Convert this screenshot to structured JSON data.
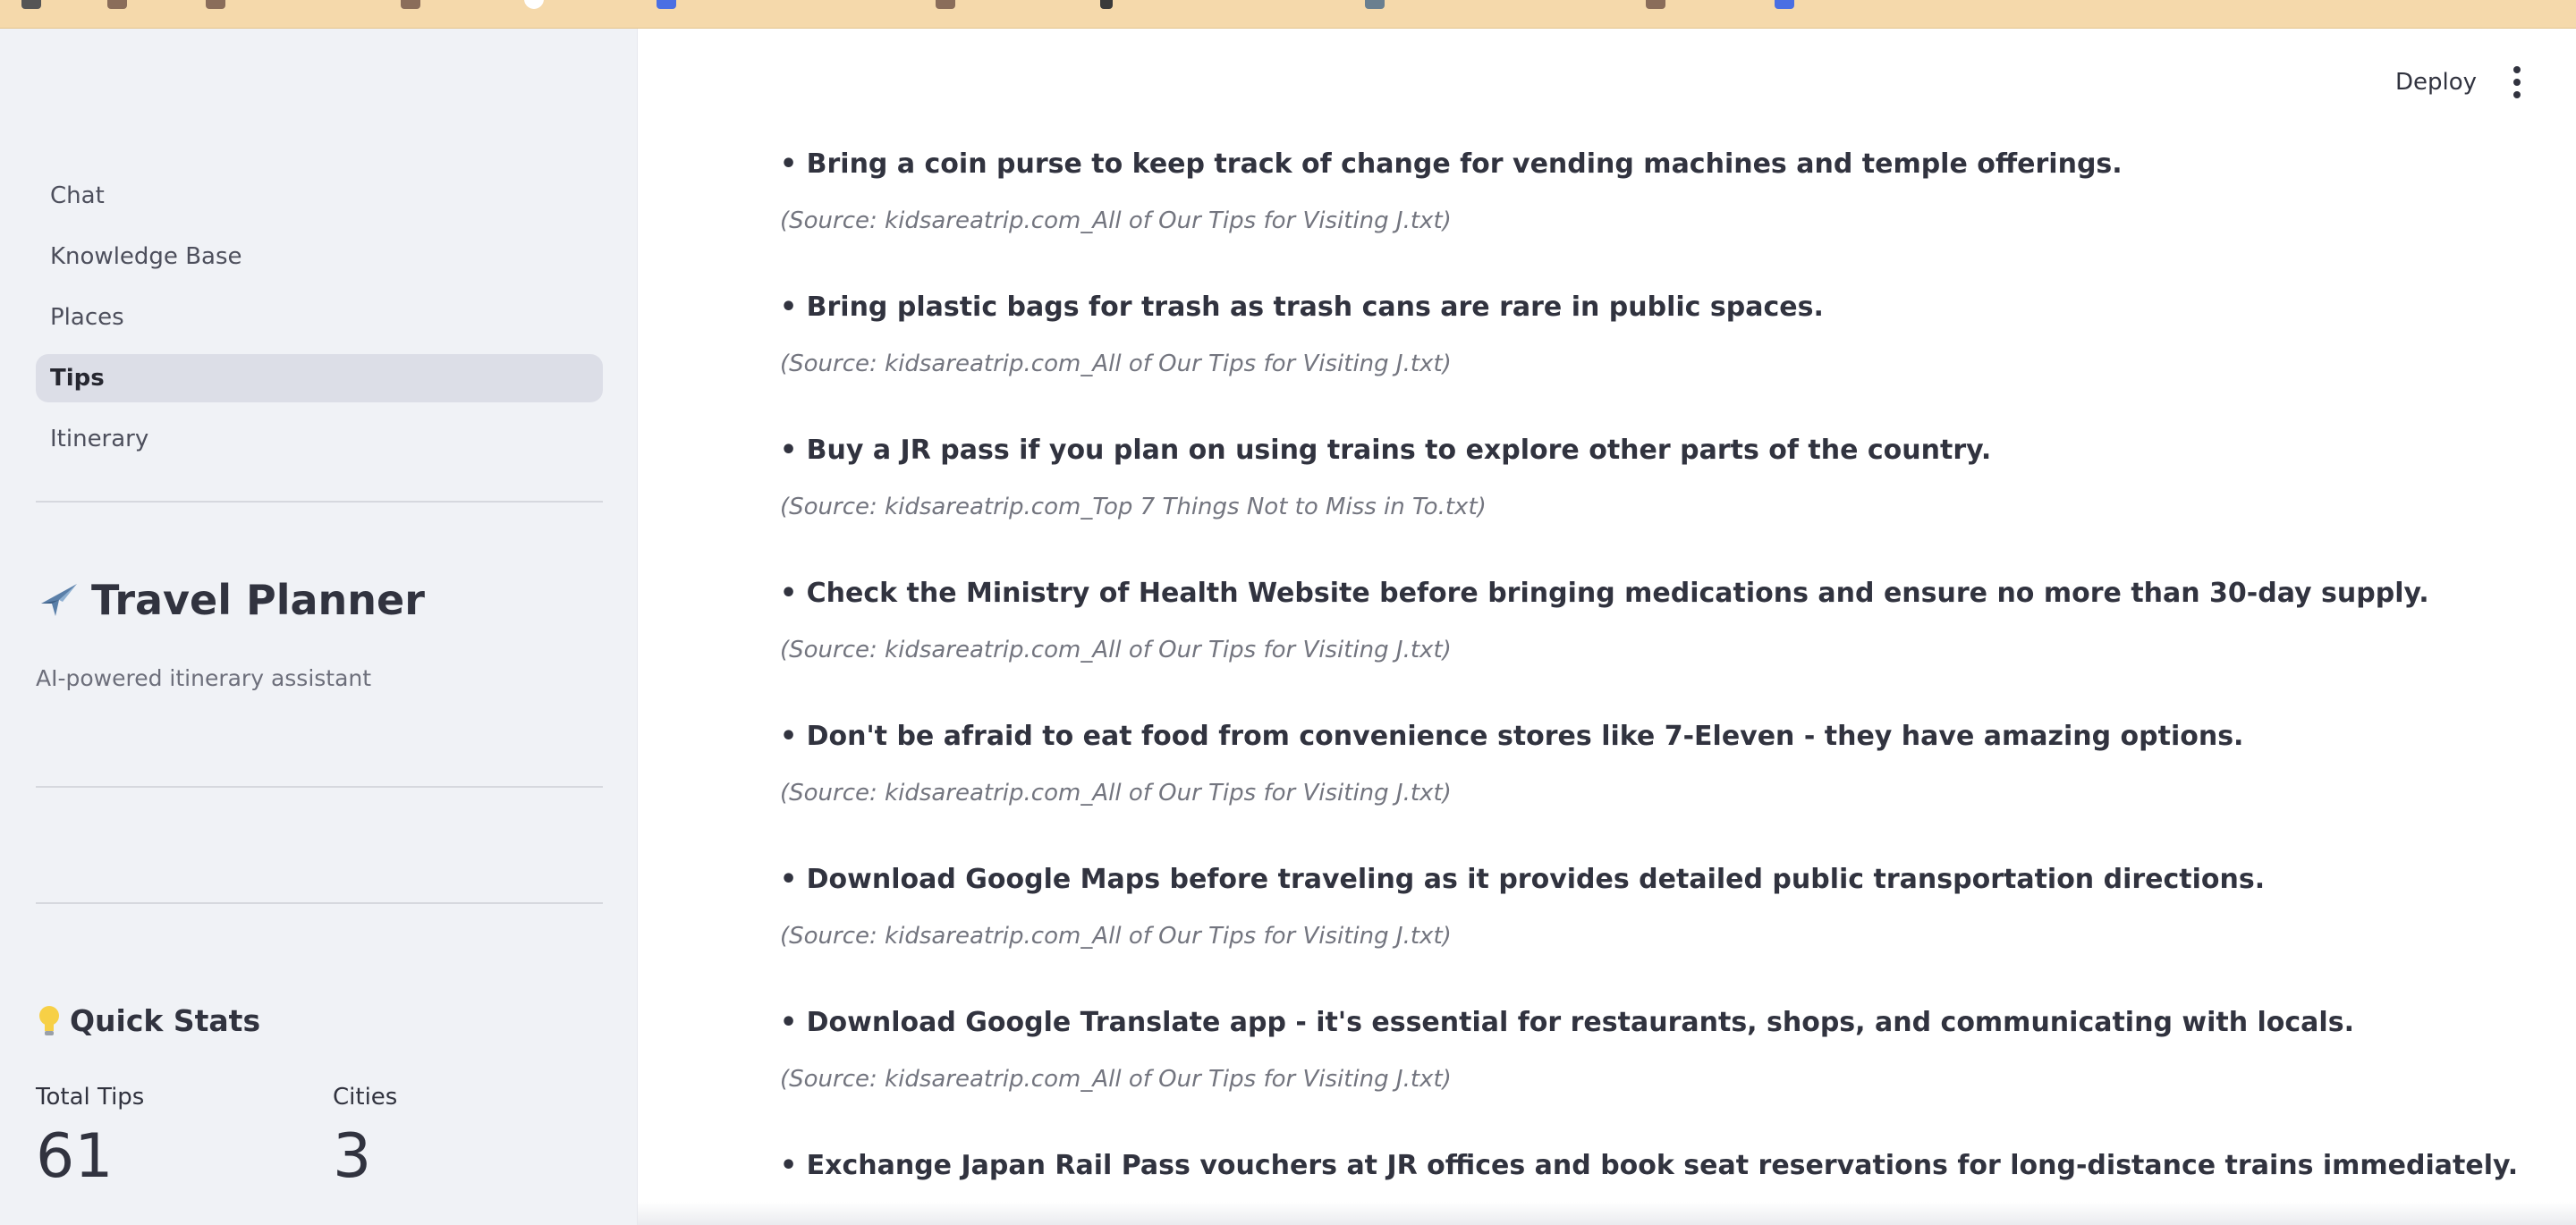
{
  "sidebar": {
    "nav_items": [
      {
        "label": "Chat",
        "active": false
      },
      {
        "label": "Knowledge Base",
        "active": false
      },
      {
        "label": "Places",
        "active": false
      },
      {
        "label": "Tips",
        "active": true
      },
      {
        "label": "Itinerary",
        "active": false
      }
    ],
    "app_title": "Travel Planner",
    "app_title_icon": "airplane-icon",
    "app_subtitle": "AI-powered itinerary assistant",
    "stats_title": "Quick Stats",
    "stats_icon": "lightbulb-icon",
    "metrics": [
      {
        "label": "Total Tips",
        "value": "61"
      },
      {
        "label": "Cities",
        "value": "3"
      }
    ]
  },
  "header": {
    "deploy_label": "Deploy",
    "menu_icon": "more-vert-icon"
  },
  "tips": [
    {
      "text": "• Bring a coin purse to keep track of change for vending machines and temple offerings.",
      "source": "(Source: kidsareatrip.com_All of Our Tips for Visiting J.txt)"
    },
    {
      "text": "• Bring plastic bags for trash as trash cans are rare in public spaces.",
      "source": "(Source: kidsareatrip.com_All of Our Tips for Visiting J.txt)"
    },
    {
      "text": "• Buy a JR pass if you plan on using trains to explore other parts of the country.",
      "source": "(Source: kidsareatrip.com_Top 7 Things Not to Miss in To.txt)"
    },
    {
      "text": "• Check the Ministry of Health Website before bringing medications and ensure no more than 30-day supply.",
      "source": "(Source: kidsareatrip.com_All of Our Tips for Visiting J.txt)"
    },
    {
      "text": "• Don't be afraid to eat food from convenience stores like 7-Eleven - they have amazing options.",
      "source": "(Source: kidsareatrip.com_All of Our Tips for Visiting J.txt)"
    },
    {
      "text": "• Download Google Maps before traveling as it provides detailed public transportation directions.",
      "source": "(Source: kidsareatrip.com_All of Our Tips for Visiting J.txt)"
    },
    {
      "text": "• Download Google Translate app - it's essential for restaurants, shops, and communicating with locals.",
      "source": "(Source: kidsareatrip.com_All of Our Tips for Visiting J.txt)"
    },
    {
      "text": "• Exchange Japan Rail Pass vouchers at JR offices and book seat reservations for long-distance trains immediately.",
      "source": ""
    }
  ],
  "colors": {
    "sidebar_bg": "#f0f2f6",
    "active_nav_bg": "#dcdee7",
    "text": "#31333f",
    "muted_text": "#73757f",
    "browser_strip": "#f5d9ab"
  }
}
